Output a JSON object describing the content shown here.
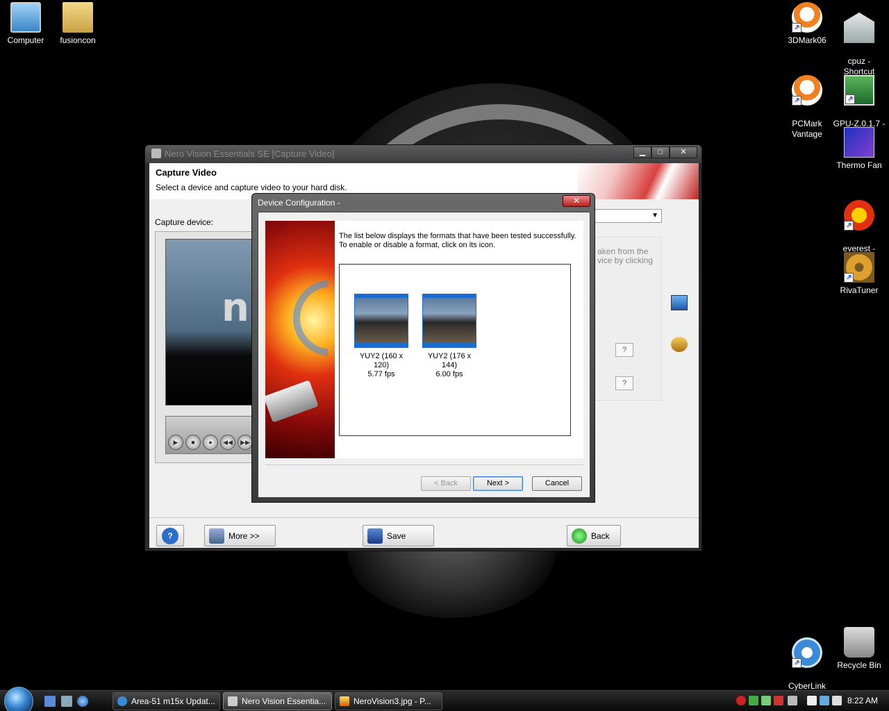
{
  "desktop_icons": {
    "computer": "Computer",
    "fusioncon": "fusioncon",
    "mark3d": "3DMark06",
    "cpuz": "cpuz -\nShortcut",
    "pcmark": "PCMark\nVantage",
    "gpuz": "GPU-Z.0.1.7 -\nShortcut",
    "thermo": "Thermo Fan",
    "everest": "everest -\nShortcut",
    "rivatuner": "RivaTuner",
    "youcam": "CyberLink\nYouCam",
    "recycle": "Recycle Bin"
  },
  "main_window": {
    "title": "Nero Vision Essentials SE [Capture Video]",
    "header_title": "Capture Video",
    "header_subtitle": "Select a device and capture video to your hard disk.",
    "capture_device_label": "Capture device:",
    "hint_text": "aken from the\nvice by clicking",
    "help_label": "?",
    "more_label": "More >>",
    "save_label": "Save",
    "back_label": "Back",
    "preview_logo": "n"
  },
  "dialog": {
    "title": "Device Configuration -",
    "description": "The list below displays the formats that have been tested successfully. To enable or disable a format, click on its icon.",
    "formats": [
      {
        "label": "YUY2 (160 x\n120)\n5.77 fps"
      },
      {
        "label": "YUY2 (176 x\n144)\n6.00 fps"
      }
    ],
    "back_button": "< Back",
    "next_button": "Next >",
    "cancel_button": "Cancel",
    "close_glyph": "✕"
  },
  "taskbar": {
    "tasks": [
      {
        "label": "Area-51 m15x Updat..."
      },
      {
        "label": "Nero Vision Essentia..."
      },
      {
        "label": "NeroVision3.jpg - P..."
      }
    ],
    "clock": "8:22 AM"
  },
  "colors": {
    "accent": "#1c6ccf",
    "dialog_bg": "#f0f0f0"
  }
}
